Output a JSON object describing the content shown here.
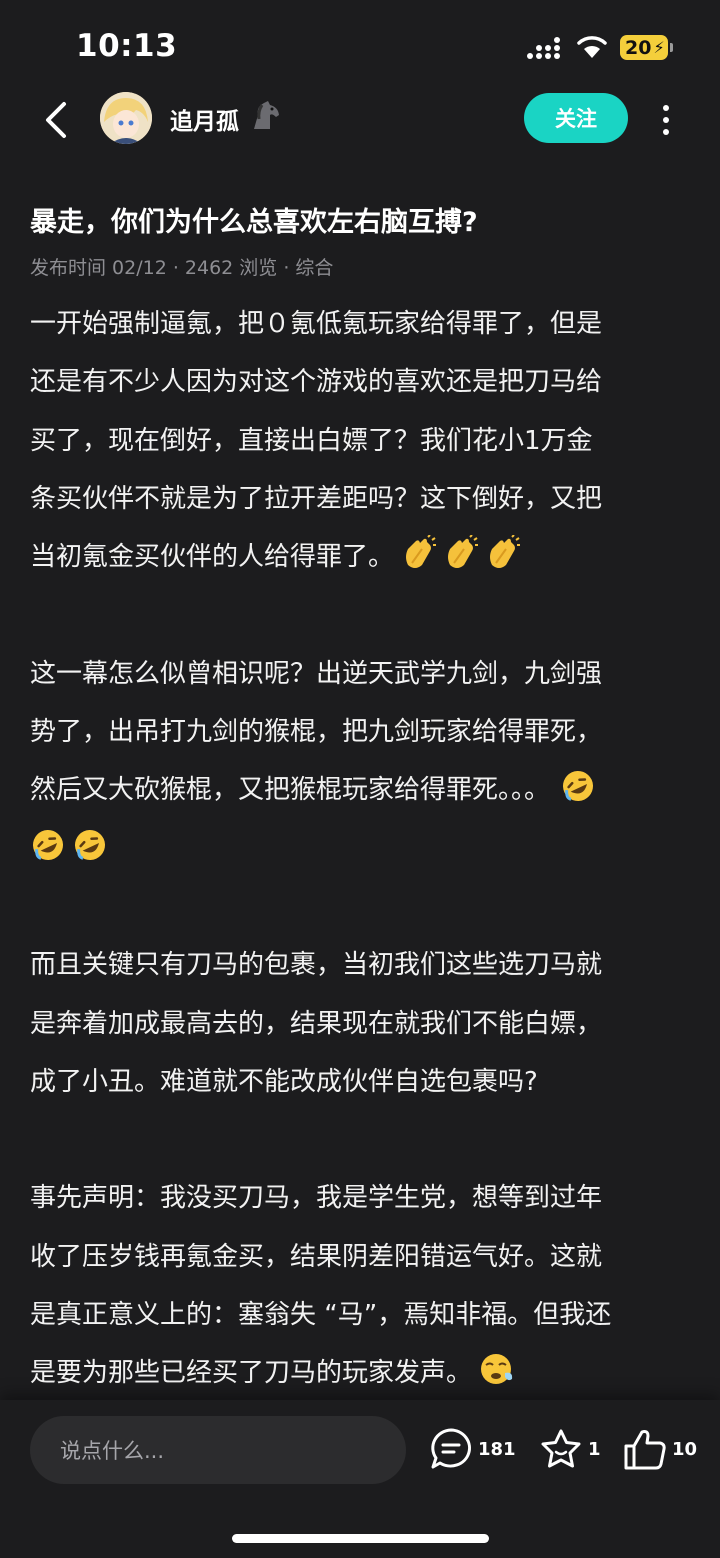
{
  "status_bar": {
    "time": "10:13",
    "battery": "20"
  },
  "header": {
    "username": "追月孤",
    "follow_label": "关注"
  },
  "article": {
    "title": "暴走，你们为什么总喜欢左右脑互搏?",
    "meta": "发布时间 02/12 · 2462 浏览 · 综合",
    "lines": [
      "一开始强制逼氪，把０氪低氪玩家给得罪了，但是",
      "还是有不少人因为对这个游戏的喜欢还是把刀马给",
      "买了，现在倒好，直接出白嫖了？我们花小1万金",
      "条买伙伴不就是为了拉开差距吗？这下倒好，又把",
      "当初氪金买伙伴的人给得罪了。",
      "这一幕怎么似曾相识呢？出逆天武学九剑，九剑强",
      "势了，出吊打九剑的猴棍，把九剑玩家给得罪死，",
      "然后又大砍猴棍，又把猴棍玩家给得罪死。。。",
      "而且关键只有刀马的包裹，当初我们这些选刀马就",
      "是奔着加成最高去的，结果现在就我们不能白嫖，",
      "成了小丑。难道就不能改成伙伴自选包裹吗?",
      "事先声明：我没买刀马，我是学生党，想等到过年",
      "收了压岁钱再氪金买，结果阴差阳错运气好。这就",
      "是真正意义上的：塞翁失 “马”，焉知非福。但我还",
      "是要为那些已经买了刀马的玩家发声。"
    ]
  },
  "bottom_bar": {
    "comment_placeholder": "说点什么...",
    "comments": "181",
    "favorites": "1",
    "likes": "10"
  },
  "icons": [
    "back-icon",
    "horse-emoji-icon",
    "more-icon",
    "clap-emoji-icon",
    "rofl-emoji-icon",
    "sweat-emoji-icon",
    "comment-icon",
    "star-icon",
    "thumbs-up-icon"
  ],
  "colors": {
    "background": "#1c1c1e",
    "accent": "#1ad4c4",
    "battery": "#f4cf3b"
  }
}
